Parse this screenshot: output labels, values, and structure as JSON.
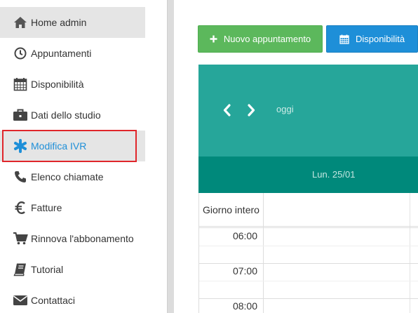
{
  "sidebar": {
    "items": [
      {
        "label": "Home admin",
        "icon": "home-icon"
      },
      {
        "label": "Appuntamenti",
        "icon": "clock-icon"
      },
      {
        "label": "Disponibilità",
        "icon": "calendar-icon"
      },
      {
        "label": "Dati dello studio",
        "icon": "briefcase-icon"
      },
      {
        "label": "Modifica IVR",
        "icon": "asterisk-icon"
      },
      {
        "label": "Elenco chiamate",
        "icon": "phone-icon"
      },
      {
        "label": "Fatture",
        "icon": "euro-icon"
      },
      {
        "label": "Rinnova l'abbonamento",
        "icon": "cart-icon"
      },
      {
        "label": "Tutorial",
        "icon": "book-icon"
      },
      {
        "label": "Contattaci",
        "icon": "envelope-icon"
      }
    ],
    "active_index": 4,
    "colors": {
      "active_text": "#1e8fd8",
      "highlight_border": "#e0262b",
      "item_bg": "#e5e5e5"
    }
  },
  "toolbar": {
    "new_appointment_label": "Nuovo appuntamento",
    "availability_label": "Disponibilità",
    "colors": {
      "new_button": "#5cb85c",
      "availability_button": "#1e8fd8"
    }
  },
  "calendar": {
    "today_label": "oggi",
    "day_label": "Lun. 25/01",
    "all_day_label": "Giorno intero",
    "times": [
      "06:00",
      "07:00",
      "08:00"
    ],
    "colors": {
      "header": "#26a69a",
      "day_row": "#00897b"
    }
  }
}
